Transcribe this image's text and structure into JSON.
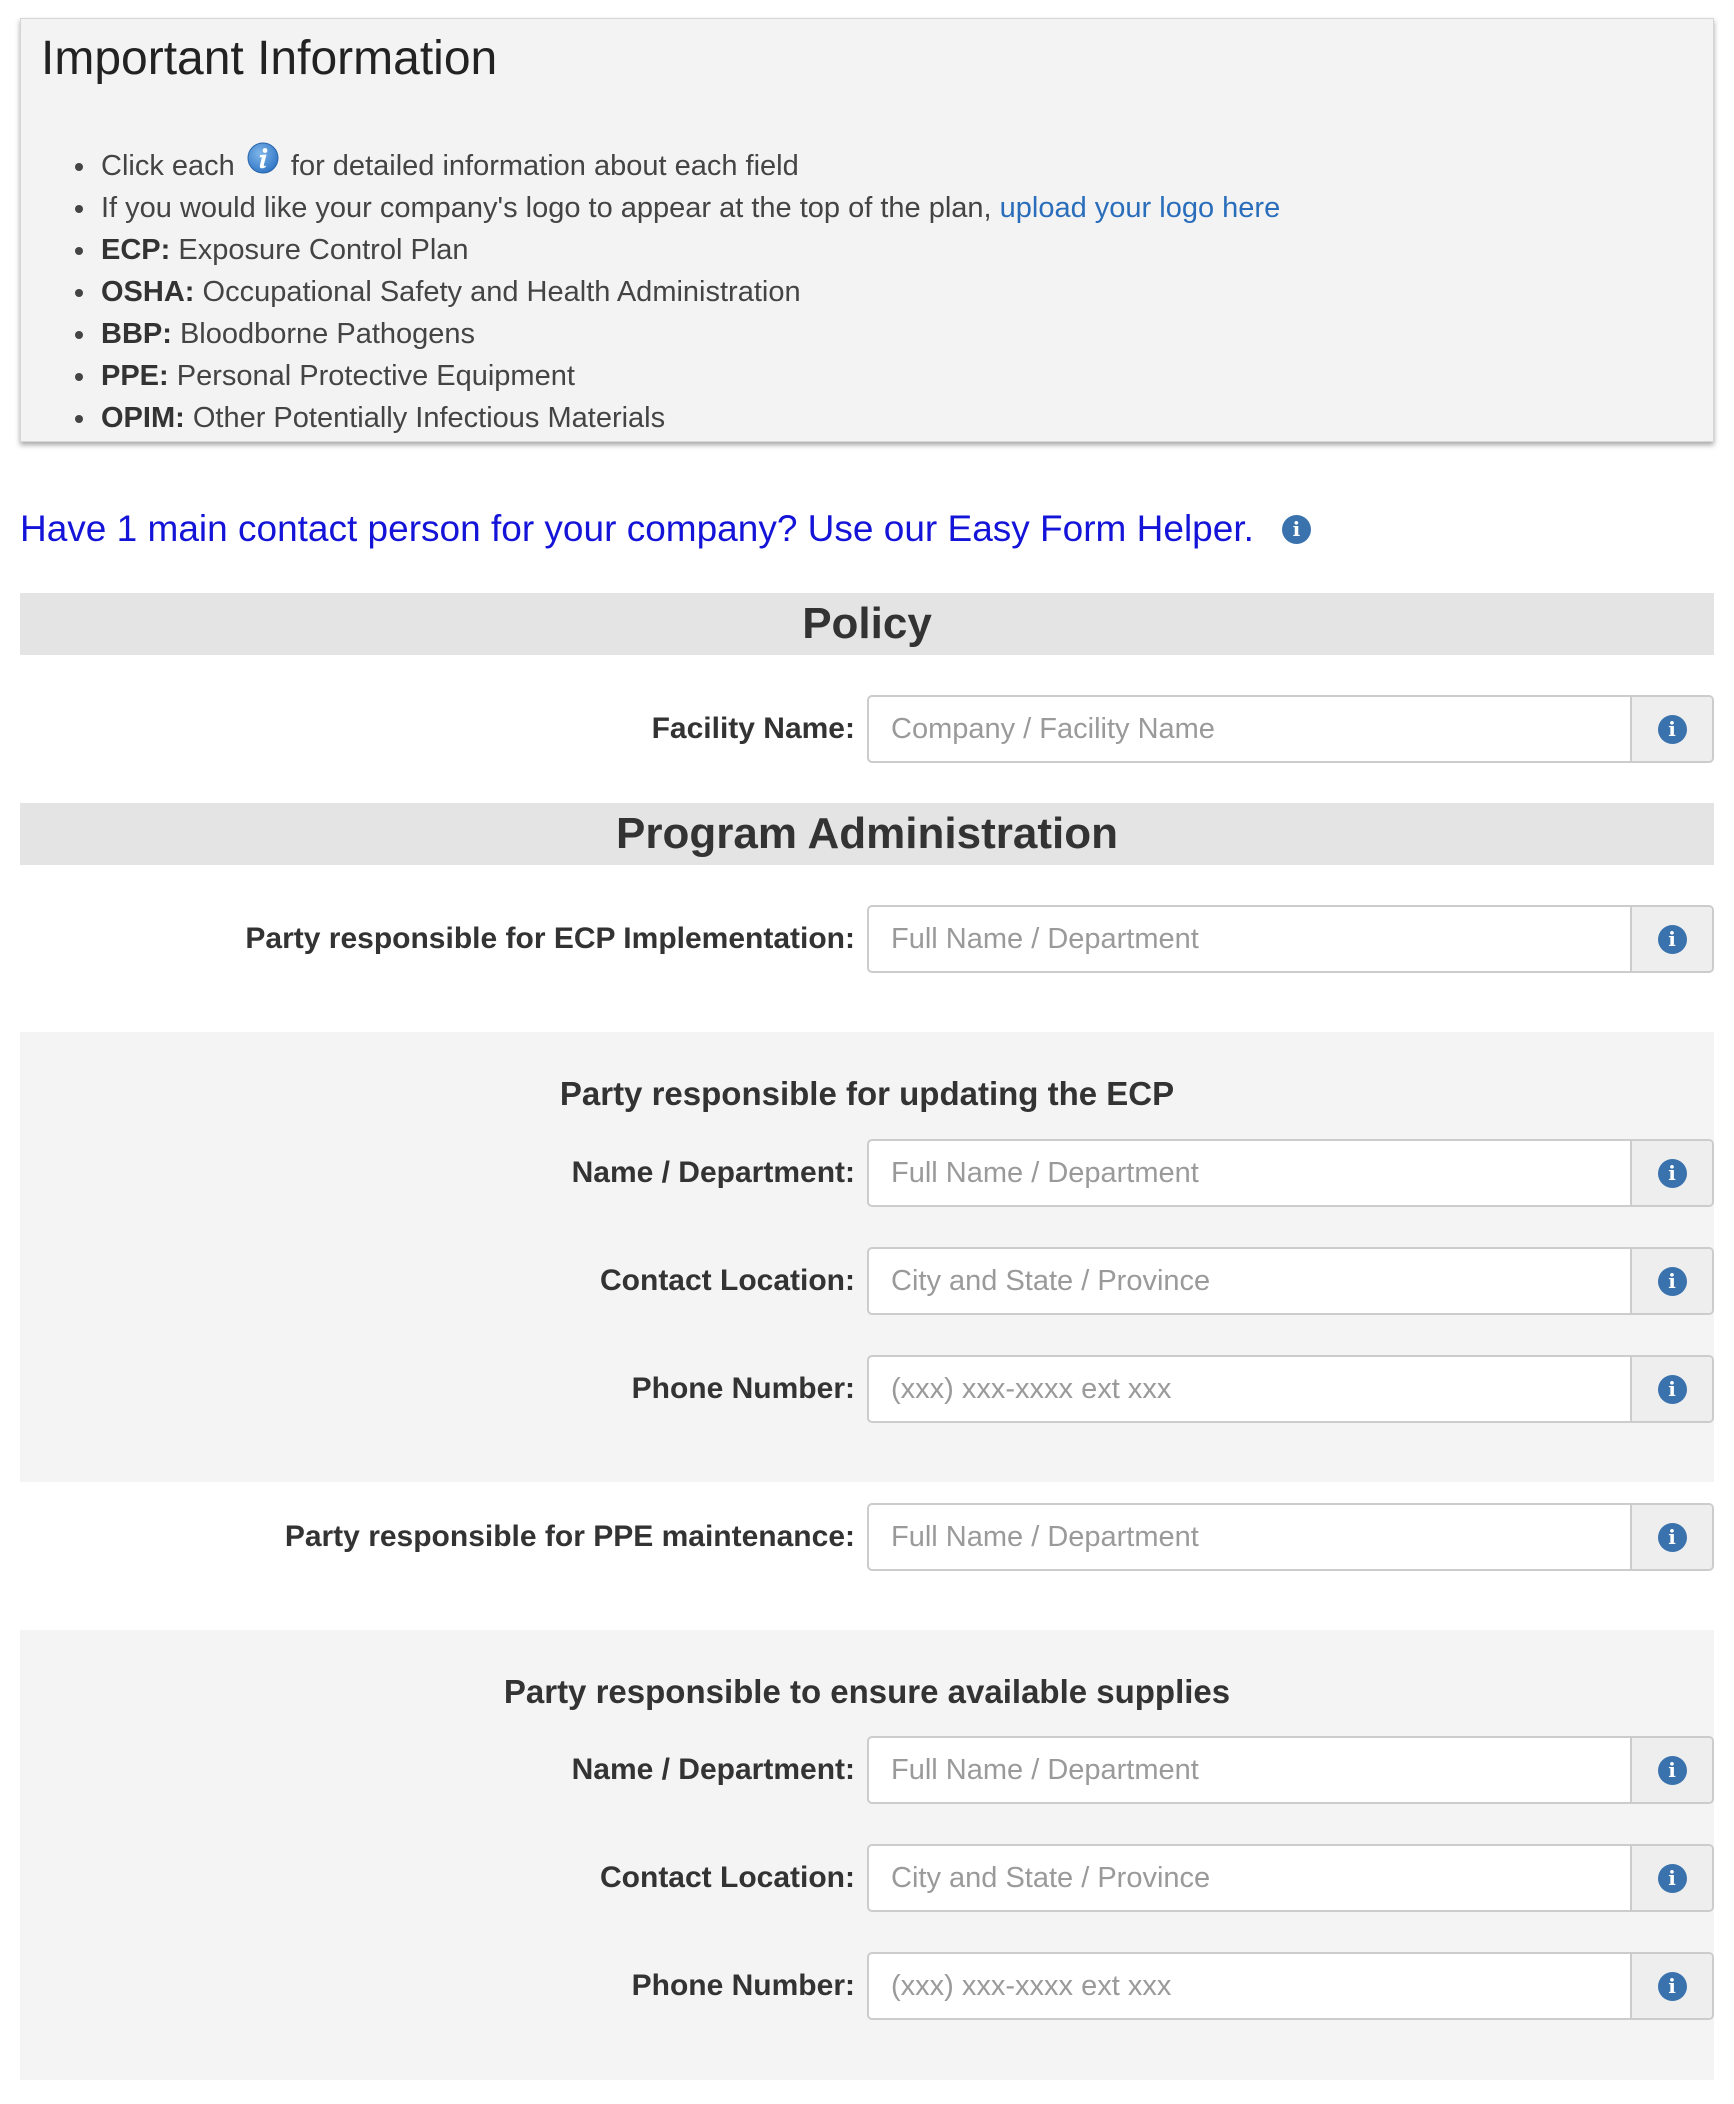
{
  "info": {
    "title": "Important Information",
    "items": [
      {
        "prefix": "Click each",
        "suffix": "for detailed information about each field"
      },
      {
        "text": "If you would like your company's logo to appear at the top of the plan,",
        "link": "upload your logo here"
      },
      {
        "term": "ECP:",
        "desc": "Exposure Control Plan"
      },
      {
        "term": "OSHA:",
        "desc": "Occupational Safety and Health Administration"
      },
      {
        "term": "BBP:",
        "desc": "Bloodborne Pathogens"
      },
      {
        "term": "PPE:",
        "desc": "Personal Protective Equipment"
      },
      {
        "term": "OPIM:",
        "desc": "Other Potentially Infectious Materials"
      }
    ]
  },
  "helper": {
    "text": "Have 1 main contact person for your company? Use our Easy Form Helper."
  },
  "sections": {
    "policy": "Policy",
    "program_admin": "Program Administration"
  },
  "fields": {
    "facility_name": {
      "label": "Facility Name:",
      "placeholder": "Company / Facility Name",
      "value": ""
    },
    "ecp_impl": {
      "label": "Party responsible for ECP Implementation:",
      "placeholder": "Full Name / Department",
      "value": ""
    },
    "ppe_maint": {
      "label": "Party responsible for PPE maintenance:",
      "placeholder": "Full Name / Department",
      "value": ""
    }
  },
  "updating": {
    "title": "Party responsible for updating the ECP",
    "name": {
      "label": "Name / Department:",
      "placeholder": "Full Name / Department",
      "value": ""
    },
    "location": {
      "label": "Contact Location:",
      "placeholder": "City and State / Province",
      "value": ""
    },
    "phone": {
      "label": "Phone Number:",
      "placeholder": "(xxx) xxx-xxxx ext xxx",
      "value": ""
    }
  },
  "supplies": {
    "title": "Party responsible to ensure available supplies",
    "name": {
      "label": "Name / Department:",
      "placeholder": "Full Name / Department",
      "value": ""
    },
    "location": {
      "label": "Contact Location:",
      "placeholder": "City and State / Province",
      "value": ""
    },
    "phone": {
      "label": "Phone Number:",
      "placeholder": "(xxx) xxx-xxxx ext xxx",
      "value": ""
    }
  },
  "icons": {
    "info": "info-icon",
    "info_glyph": "i"
  },
  "colors": {
    "link": "#2a6ebb",
    "helper_link": "#1414d9",
    "info_icon": "#3a72ad",
    "section_header_bg": "#e4e4e4"
  }
}
